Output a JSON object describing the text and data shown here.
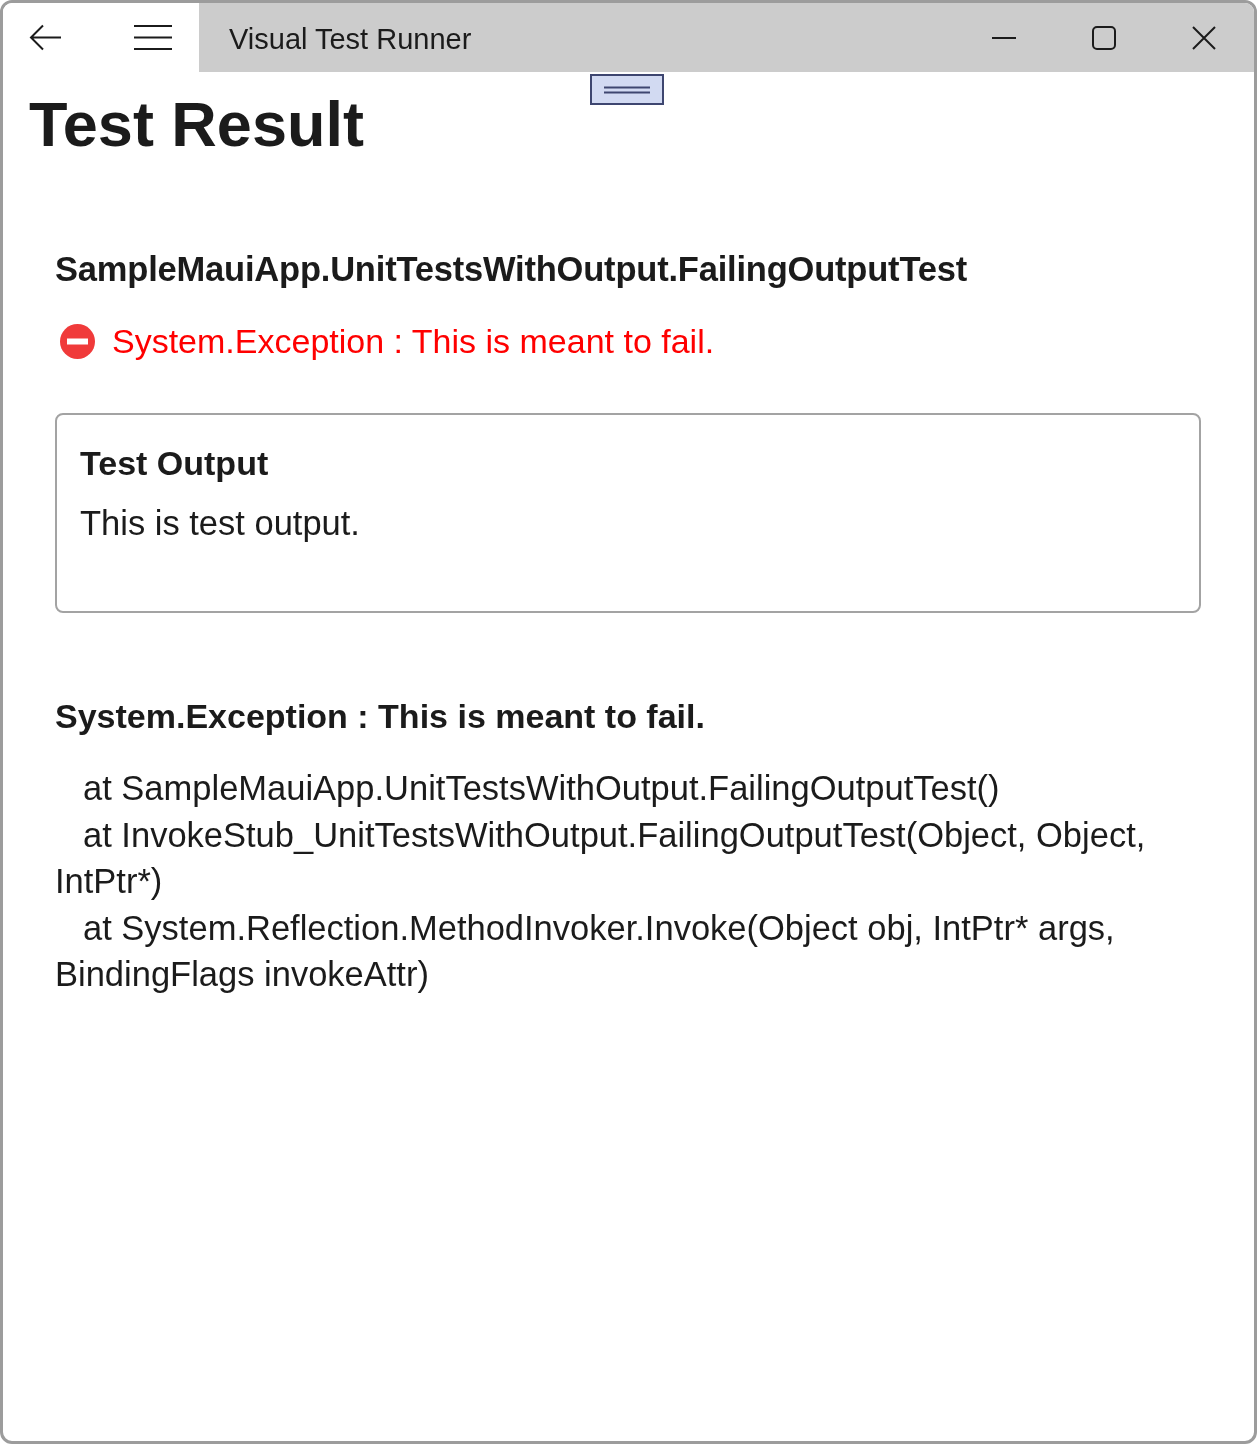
{
  "window": {
    "title": "Visual Test Runner"
  },
  "page": {
    "title": "Test Result"
  },
  "test": {
    "name": "SampleMauiApp.UnitTestsWithOutput.FailingOutputTest",
    "failed": true,
    "message": "System.Exception : This is meant to fail."
  },
  "output_panel": {
    "title": "Test Output",
    "text": "This is test output."
  },
  "exception": {
    "title": "System.Exception : This is meant to fail.",
    "stack_trace": [
      "at SampleMauiApp.UnitTestsWithOutput.FailingOutputTest()",
      "at InvokeStub_UnitTestsWithOutput.FailingOutputTest(Object, Object, IntPtr*)",
      "at System.Reflection.MethodInvoker.Invoke(Object obj, IntPtr* args, BindingFlags invokeAttr)"
    ]
  }
}
